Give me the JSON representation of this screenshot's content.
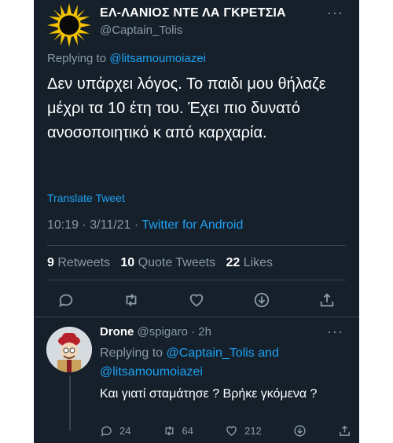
{
  "tweet": {
    "display_name": "ΕΛ-ΛΑΝΙΟΣ ΝΤΕ ΛΑ ΓΚΡΕΤΣΙΑ",
    "handle": "@Captain_Tolis",
    "replying_prefix": "Replying to ",
    "replying_to": "@litsamoumoiazei",
    "text": "Δεν υπάρχει λόγος. Το παιδι μου θήλαζε μέχρι τα 10 έτη του. Έχει πιο δυνατό ανοσοποιητικό κ από καρχαρία.",
    "translate": "Translate Tweet",
    "time": "10:19 · 3/11/21 · ",
    "source": "Twitter for Android",
    "retweets_count": "9",
    "retweets_label": "Retweets",
    "quote_count": "10",
    "quote_label": "Quote Tweets",
    "likes_count": "22",
    "likes_label": "Likes",
    "more": "···"
  },
  "reply": {
    "name": "Drone",
    "handle_time": "@spigaro · 2h",
    "replying_prefix": "Replying to ",
    "replying_to_1": "@Captain_Tolis",
    "replying_and": " and",
    "replying_to_2": "@litsamoumoiazei",
    "text": "Και γιατί σταμάτησε ? Βρήκε γκόμενα ?",
    "reply_count": "24",
    "retweet_count": "64",
    "like_count": "212",
    "more": "···"
  },
  "colors": {
    "background": "#15202b",
    "accent": "#1da1f2",
    "muted": "#8899a6"
  }
}
